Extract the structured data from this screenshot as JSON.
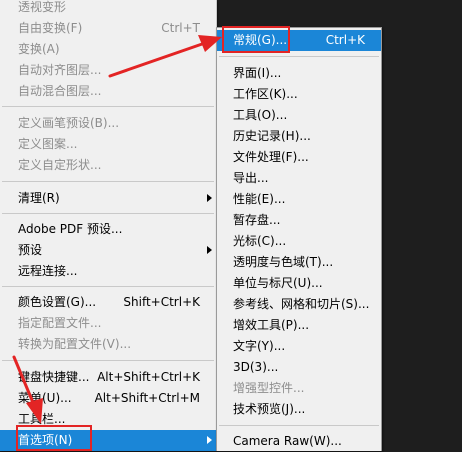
{
  "main_menu": {
    "items": [
      {
        "label": "透视变形",
        "shortcut": "",
        "disabled": true
      },
      {
        "label": "自由变换(F)",
        "shortcut": "Ctrl+T",
        "disabled": true
      },
      {
        "label": "变换(A)",
        "shortcut": "",
        "disabled": true
      },
      {
        "label": "自动对齐图层...",
        "shortcut": "",
        "disabled": true
      },
      {
        "label": "自动混合图层...",
        "shortcut": "",
        "disabled": true
      },
      {
        "label": "定义画笔预设(B)...",
        "shortcut": "",
        "disabled": true
      },
      {
        "label": "定义图案...",
        "shortcut": "",
        "disabled": true
      },
      {
        "label": "定义自定形状...",
        "shortcut": "",
        "disabled": true
      },
      {
        "label": "清理(R)",
        "shortcut": "",
        "disabled": false
      },
      {
        "label": "Adobe PDF 预设...",
        "shortcut": "",
        "disabled": false
      },
      {
        "label": "预设",
        "shortcut": "",
        "disabled": false
      },
      {
        "label": "远程连接...",
        "shortcut": "",
        "disabled": false
      },
      {
        "label": "颜色设置(G)...",
        "shortcut": "Shift+Ctrl+K",
        "disabled": false
      },
      {
        "label": "指定配置文件...",
        "shortcut": "",
        "disabled": true
      },
      {
        "label": "转换为配置文件(V)...",
        "shortcut": "",
        "disabled": true
      },
      {
        "label": "键盘快捷键...",
        "shortcut": "Alt+Shift+Ctrl+K",
        "disabled": false
      },
      {
        "label": "菜单(U)...",
        "shortcut": "Alt+Shift+Ctrl+M",
        "disabled": false
      },
      {
        "label": "工具栏...",
        "shortcut": "",
        "disabled": false
      },
      {
        "label": "首选项(N)",
        "shortcut": "",
        "disabled": false
      }
    ]
  },
  "preferences_submenu": {
    "items": [
      {
        "label": "常规(G)...",
        "shortcut": "Ctrl+K",
        "disabled": false
      },
      {
        "label": "界面(I)...",
        "shortcut": "",
        "disabled": false
      },
      {
        "label": "工作区(K)...",
        "shortcut": "",
        "disabled": false
      },
      {
        "label": "工具(O)...",
        "shortcut": "",
        "disabled": false
      },
      {
        "label": "历史记录(H)...",
        "shortcut": "",
        "disabled": false
      },
      {
        "label": "文件处理(F)...",
        "shortcut": "",
        "disabled": false
      },
      {
        "label": "导出...",
        "shortcut": "",
        "disabled": false
      },
      {
        "label": "性能(E)...",
        "shortcut": "",
        "disabled": false
      },
      {
        "label": "暂存盘...",
        "shortcut": "",
        "disabled": false
      },
      {
        "label": "光标(C)...",
        "shortcut": "",
        "disabled": false
      },
      {
        "label": "透明度与色域(T)...",
        "shortcut": "",
        "disabled": false
      },
      {
        "label": "单位与标尺(U)...",
        "shortcut": "",
        "disabled": false
      },
      {
        "label": "参考线、网格和切片(S)...",
        "shortcut": "",
        "disabled": false
      },
      {
        "label": "增效工具(P)...",
        "shortcut": "",
        "disabled": false
      },
      {
        "label": "文字(Y)...",
        "shortcut": "",
        "disabled": false
      },
      {
        "label": "3D(3)...",
        "shortcut": "",
        "disabled": false
      },
      {
        "label": "增强型控件...",
        "shortcut": "",
        "disabled": true
      },
      {
        "label": "技术预览(J)...",
        "shortcut": "",
        "disabled": false
      },
      {
        "label": "Camera Raw(W)...",
        "shortcut": "",
        "disabled": false
      }
    ]
  },
  "annotation_color": "#e32424",
  "highlight_color": "#1b86d7"
}
